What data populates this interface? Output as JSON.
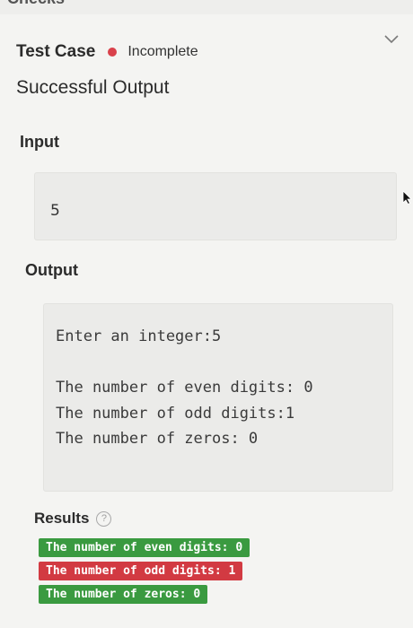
{
  "header": {
    "partial_title": "Checks"
  },
  "test_case": {
    "title": "Test Case",
    "status": "Incomplete",
    "status_color": "#d9414b",
    "expand_icon": "chevron-down-icon",
    "name": "Successful Output"
  },
  "input": {
    "label": "Input",
    "value": "5"
  },
  "output": {
    "label": "Output",
    "lines": [
      "Enter an integer:5",
      "The number of even digits: 0",
      "The number of odd digits:1",
      "The number of zeros: 0"
    ]
  },
  "results": {
    "label": "Results",
    "help_icon": "question-circle-icon",
    "items": [
      {
        "text": "The number of even digits: 0",
        "status": "pass",
        "color": "#3a9a40"
      },
      {
        "text": "The number of odd digits: 1",
        "status": "fail",
        "color": "#d23a42"
      },
      {
        "text": "The number of zeros: 0",
        "status": "pass",
        "color": "#3a9a40"
      }
    ]
  }
}
